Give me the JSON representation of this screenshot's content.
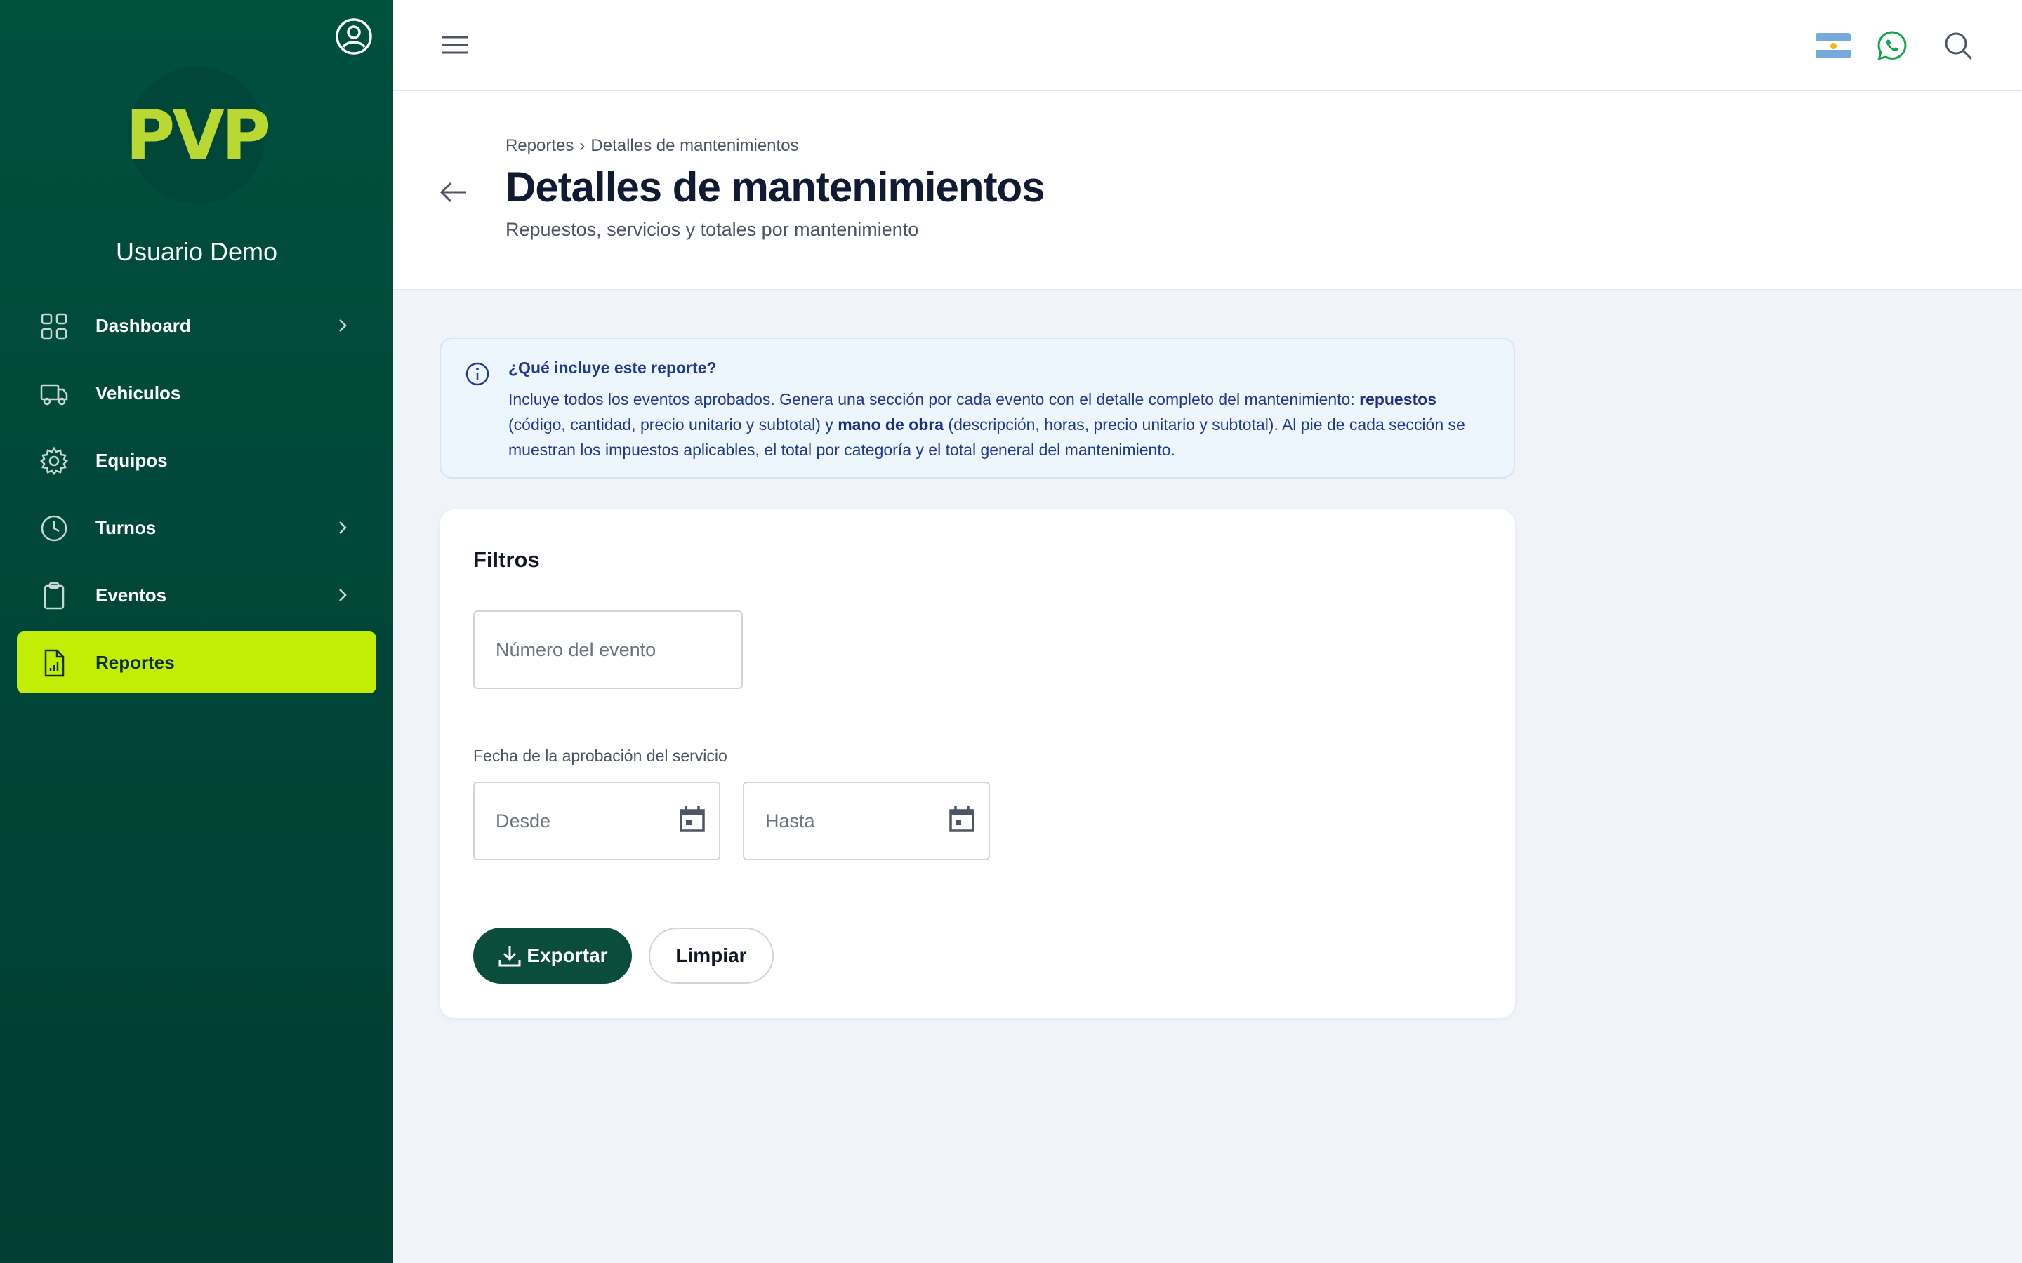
{
  "sidebar": {
    "logo_text": "PVP",
    "username": "Usuario Demo",
    "items": [
      {
        "label": "Dashboard",
        "has_chevron": true
      },
      {
        "label": "Vehiculos",
        "has_chevron": false
      },
      {
        "label": "Equipos",
        "has_chevron": false
      },
      {
        "label": "Turnos",
        "has_chevron": true
      },
      {
        "label": "Eventos",
        "has_chevron": true
      },
      {
        "label": "Reportes",
        "has_chevron": false,
        "active": true
      }
    ],
    "active_color": "#c2ee06",
    "background_color": "#00503e"
  },
  "topbar": {
    "icons": [
      "menu-icon",
      "argentina-flag-icon",
      "whatsapp-icon",
      "search-icon"
    ]
  },
  "header": {
    "breadcrumb": [
      "Reportes",
      "Detalles de mantenimientos"
    ],
    "breadcrumb_separator": "›",
    "title": "Detalles de mantenimientos",
    "subtitle": "Repuestos, servicios y totales por mantenimiento"
  },
  "info": {
    "title": "¿Qué incluye este reporte?",
    "text_part1": "Incluye todos los eventos aprobados. Genera una sección por cada evento con el detalle completo del mantenimiento: ",
    "bold1": "repuestos",
    "text_part2": " (código, cantidad, precio unitario y subtotal) y ",
    "bold2": "mano de obra",
    "text_part3": " (descripción, horas, precio unitario y subtotal). Al pie de cada sección se muestran los impuestos aplicables, el total por categoría y el total general del mantenimiento."
  },
  "filters": {
    "title": "Filtros",
    "event_number_placeholder": "Número del evento",
    "date_label": "Fecha de la aprobación del servicio",
    "date_from_placeholder": "Desde",
    "date_to_placeholder": "Hasta",
    "export_label": "Exportar",
    "clear_label": "Limpiar"
  }
}
